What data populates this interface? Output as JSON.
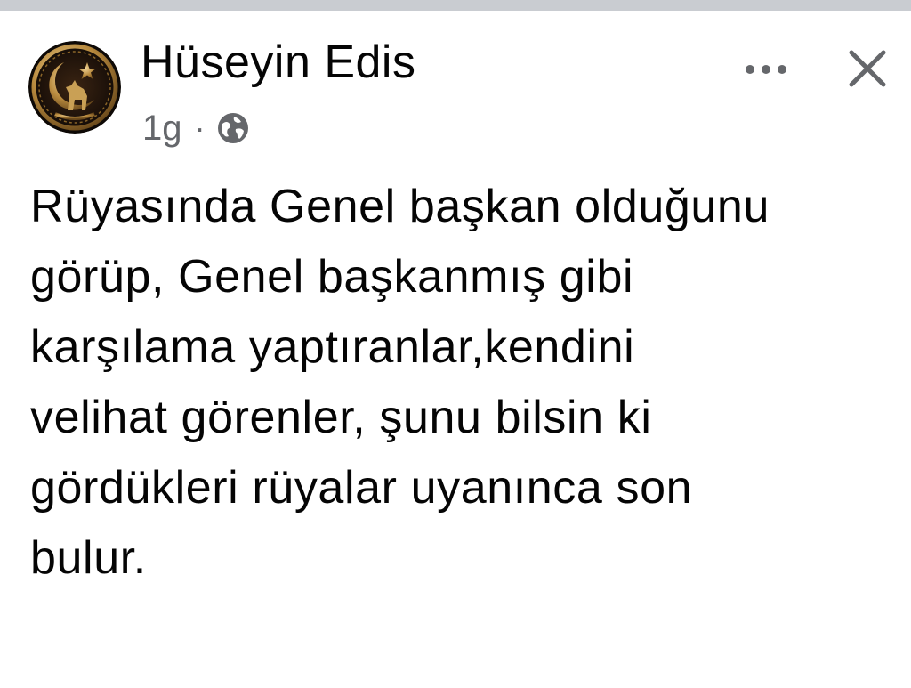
{
  "post": {
    "author": "Hüseyin Edis",
    "timestamp": "1g",
    "separator": "·",
    "audience_icon": "globe-icon",
    "more_icon": "more-options-icon",
    "close_icon": "close-icon",
    "text": "Rüyasında Genel başkan olduğunu\ngörüp, Genel başkanmış gibi\nkarşılama yaptıranlar,kendini\nvelihat görenler, şunu bilsin ki\ngördükleri rüyalar uyanınca son\nbulur."
  },
  "colors": {
    "text_primary": "#050505",
    "text_secondary": "#65676b",
    "top_bar": "#c9ccd1",
    "background": "#ffffff"
  }
}
